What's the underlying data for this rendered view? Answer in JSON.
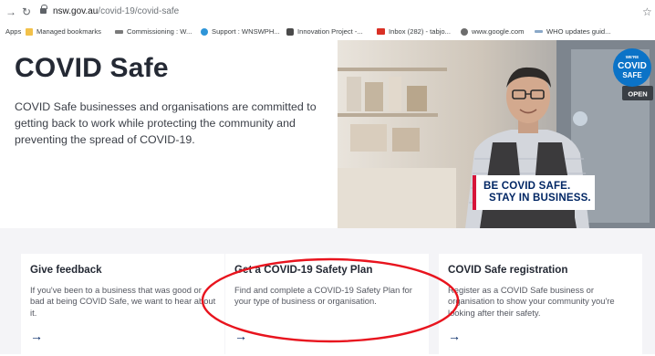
{
  "browser": {
    "back_icon": "arrow-right",
    "reload_icon": "reload",
    "url_host": "nsw.gov.au",
    "url_path": "/covid-19/covid-safe",
    "bookmarks": [
      {
        "label": "Apps",
        "icon": ""
      },
      {
        "label": "Managed bookmarks",
        "icon": "folder"
      },
      {
        "label": "Commissioning : W...",
        "icon": "grey"
      },
      {
        "label": "Support : WNSWPH...",
        "icon": "blue"
      },
      {
        "label": "Innovation Project -...",
        "icon": "dark"
      },
      {
        "label": "Inbox (282) - tabjo...",
        "icon": "gmail"
      },
      {
        "label": "www.google.com",
        "icon": "globe"
      },
      {
        "label": "WHO updates guid...",
        "icon": "who"
      }
    ]
  },
  "hero": {
    "title": "COVID Safe",
    "text": "COVID Safe businesses and organisations are committed to getting back to work while protecting the community and preventing the spread of COVID-19.",
    "image_banner_line1": "BE COVID SAFE.",
    "image_banner_line2": "STAY IN BUSINESS.",
    "logo_line1": "WE'RE",
    "logo_line2": "COVID",
    "logo_line3": "SAFE",
    "shop_sign": "OPEN"
  },
  "cards": [
    {
      "title": "Give feedback",
      "body": "If you've been to a business that was good or bad at being COVID Safe, we want to hear about it.",
      "arrow": "→"
    },
    {
      "title": "Get a COVID-19 Safety Plan",
      "body": "Find and complete a COVID-19 Safety Plan for your type of business or organisation.",
      "arrow": "→"
    },
    {
      "title": "COVID Safe registration",
      "body": "Register as a COVID Safe business or organisation to show your community you're looking after their safety.",
      "arrow": "→"
    }
  ],
  "colors": {
    "nsw_blue": "#002664",
    "nsw_red": "#d7153a",
    "annotation_red": "#e8141e",
    "card_bg": "#f4f4f7"
  }
}
